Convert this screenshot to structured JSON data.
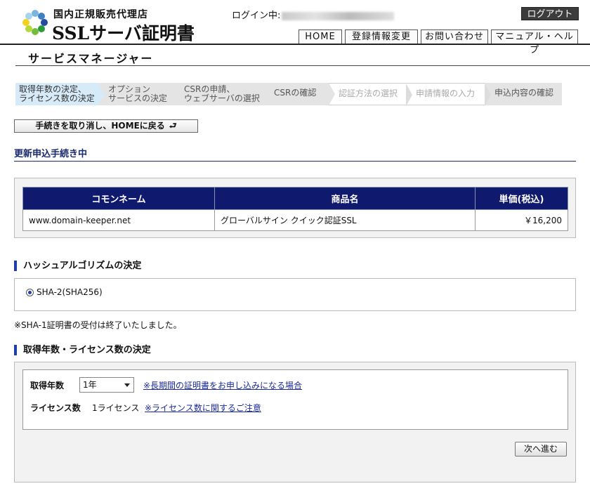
{
  "header": {
    "logo_sub": "国内正規販売代理店",
    "logo_main": "SSLサーバ証明書",
    "login_label": "ログイン中:",
    "logout_label": "ログアウト",
    "nav": [
      "HOME",
      "登録情報変更",
      "お問い合わせ",
      "マニュアル・ヘルプ"
    ],
    "service_title": "サービスマネージャー"
  },
  "steps": [
    {
      "line1": "取得年数の決定、",
      "line2": "ライセンス数の決定"
    },
    {
      "line1": "オプション",
      "line2": "サービスの決定"
    },
    {
      "line1": "CSRの申請、",
      "line2": "ウェブサーバの選択"
    },
    {
      "line1": "CSRの確認",
      "line2": ""
    },
    {
      "line1": "認証方法の選択",
      "line2": ""
    },
    {
      "line1": "申請情報の入力",
      "line2": ""
    },
    {
      "line1": "申込内容の確認",
      "line2": ""
    }
  ],
  "cancel_button": "手続きを取り消し、HOMEに戻る",
  "section_title": "更新申込手続き中",
  "product_table": {
    "headers": [
      "コモンネーム",
      "商品名",
      "単価(税込)"
    ],
    "rows": [
      {
        "common_name": "www.domain-keeper.net",
        "product": "グローバルサイン クイック認証SSL",
        "price": "￥16,200"
      }
    ]
  },
  "hash": {
    "title": "ハッシュアルゴリズムの決定",
    "option": "SHA-2(SHA256)",
    "note": "※SHA-1証明書の受付は終了いたしました。"
  },
  "term": {
    "title": "取得年数・ライセンス数の決定",
    "years_label": "取得年数",
    "years_value": "1年",
    "years_link": "※長期間の証明書をお申し込みになる場合",
    "license_label": "ライセンス数",
    "license_value": "1ライセンス",
    "license_link": "※ライセンス数に関するご注意",
    "next_button": "次へ進む"
  }
}
